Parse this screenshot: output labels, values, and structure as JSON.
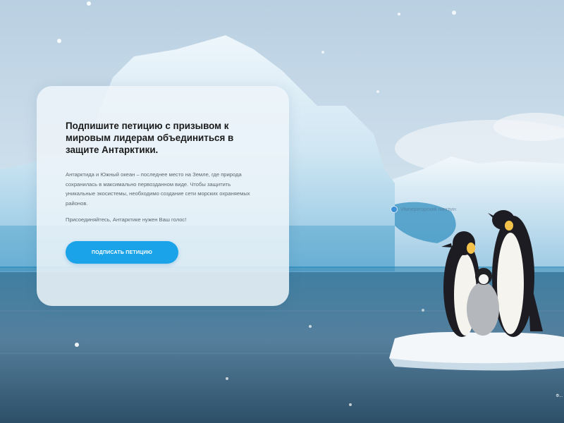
{
  "petition_card": {
    "headline": "Подпишите петицию с призывом к мировым лидерам объединиться в защите Антарктики.",
    "body": "Антарктида и Южный океан – последнее место на Земле, где природа сохранилась в максимально первозданном виде. Чтобы защитить уникальные экосистемы, необходимо создание сети морских охраняемых районов.",
    "call_to_join": "Присоединяйтесь, Антарктике нужен Ваш голос!",
    "cta_label": "ПОДПИСАТЬ ПЕТИЦИЮ"
  },
  "map_pin": {
    "label": "Императорский пингвин"
  },
  "corner_text": "Ф..."
}
